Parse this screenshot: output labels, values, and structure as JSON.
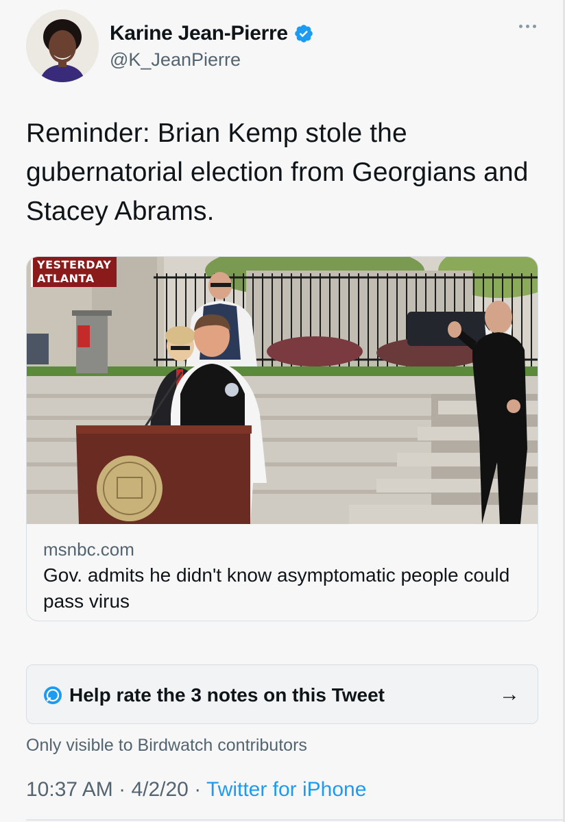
{
  "author": {
    "display_name": "Karine Jean-Pierre",
    "handle": "@K_JeanPierre",
    "verified": true,
    "icons": [
      "avatar",
      "verified-badge-icon",
      "more-options-icon"
    ]
  },
  "tweet": {
    "text": "Reminder: Brian Kemp stole the gubernatorial election from  Georgians and Stacey Abrams."
  },
  "card": {
    "image_overlay": [
      "YESTERDAY",
      "ATLANTA"
    ],
    "domain": "msnbc.com",
    "title": "Gov. admits he didn't know asymptomatic people could pass virus"
  },
  "birdwatch": {
    "prompt": "Help rate the 3 notes on this Tweet",
    "arrow": "→",
    "visibility_note": "Only visible to Birdwatch contributors",
    "icons": [
      "birdwatch-icon",
      "arrow-right-icon"
    ]
  },
  "meta": {
    "time": "10:37 AM",
    "separator": " · ",
    "date": "4/2/20",
    "source": "Twitter for iPhone"
  },
  "colors": {
    "accent": "#1d9bf0",
    "text": "#0f1419",
    "secondary": "#536471",
    "background": "#f7f7f7"
  }
}
